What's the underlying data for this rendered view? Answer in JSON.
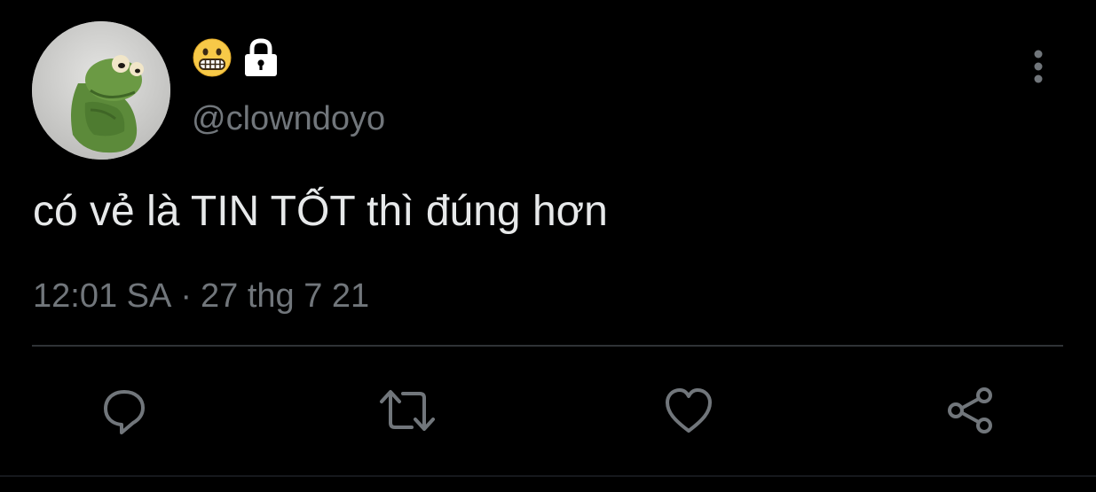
{
  "user": {
    "display_name_emojis": [
      "grimacing-face-emoji",
      "lock-icon"
    ],
    "handle": "@clowndoyo",
    "avatar": "kermit-frog-plush-photo"
  },
  "tweet": {
    "text": "có vẻ là TIN TỐT thì đúng hơn",
    "time": "12:01 SA",
    "separator": "·",
    "date": "27 thg 7 21"
  },
  "actions": [
    {
      "name": "reply",
      "icon": "comment-icon"
    },
    {
      "name": "retweet",
      "icon": "retweet-icon"
    },
    {
      "name": "like",
      "icon": "heart-icon"
    },
    {
      "name": "share",
      "icon": "share-icon"
    }
  ],
  "colors": {
    "background": "#000000",
    "text": "#e7e9ea",
    "muted": "#71767b",
    "divider": "#2f3336"
  }
}
